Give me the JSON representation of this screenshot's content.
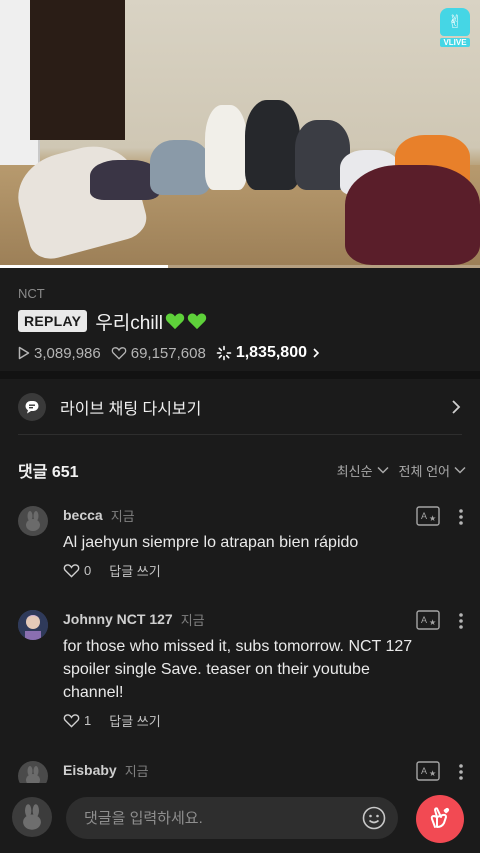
{
  "video": {
    "logo_text": "VLIVE",
    "progress": 0.35
  },
  "info": {
    "channel": "NCT",
    "badge": "REPLAY",
    "title": "우리chill",
    "plays": "3,089,986",
    "likes": "69,157,608",
    "sparkles": "1,835,800"
  },
  "chat_replay": {
    "label": "라이브 채팅 다시보기"
  },
  "comments_header": {
    "title": "댓글 651",
    "sort_label": "최신순",
    "lang_label": "전체 언어"
  },
  "comments": [
    {
      "name": "becca",
      "time": "지금",
      "text": "Al jaehyun siempre lo atrapan bien rápido",
      "likes": "0",
      "reply": "답글 쓰기"
    },
    {
      "name": "Johnny NCT 127",
      "time": "지금",
      "text": "for those who missed it, subs tomorrow. NCT 127 spoiler single Save. teaser on their youtube channel!",
      "likes": "1",
      "reply": "답글 쓰기"
    },
    {
      "name": "Eisbaby",
      "time": "지금"
    }
  ],
  "input": {
    "placeholder": "댓글을 입력하세요."
  },
  "colors": {
    "accent": "#f24a53",
    "vlive": "#45d6e5",
    "background": "#1b1b1b"
  }
}
